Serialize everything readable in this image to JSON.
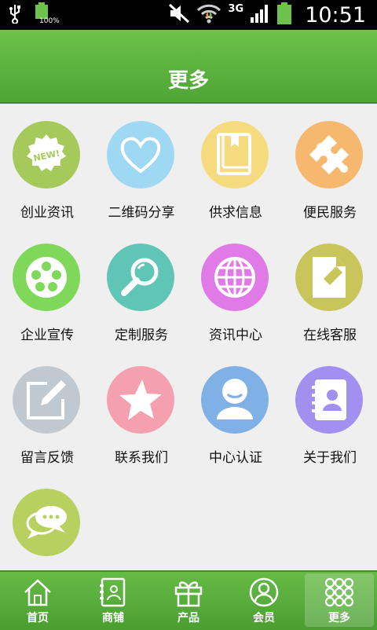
{
  "status_bar": {
    "battery_percent": "100%",
    "network": "3G",
    "time": "10:51"
  },
  "header": {
    "title": "更多"
  },
  "tiles": [
    {
      "label": "创业资讯",
      "color": "#a5c95a",
      "icon": "new-badge-icon"
    },
    {
      "label": "二维码分享",
      "color": "#9fd8f2",
      "icon": "heart-icon"
    },
    {
      "label": "供求信息",
      "color": "#f6da7e",
      "icon": "book-icon"
    },
    {
      "label": "便民服务",
      "color": "#f6b86e",
      "icon": "puzzle-icon"
    },
    {
      "label": "企业宣传",
      "color": "#7fd85a",
      "icon": "film-reel-icon"
    },
    {
      "label": "定制服务",
      "color": "#5fc6b5",
      "icon": "magnifier-icon"
    },
    {
      "label": "资讯中心",
      "color": "#e07ae6",
      "icon": "globe-icon"
    },
    {
      "label": "在线客服",
      "color": "#c8c65a",
      "icon": "document-pencil-icon"
    },
    {
      "label": "留言反馈",
      "color": "#c0c8d0",
      "icon": "edit-icon"
    },
    {
      "label": "联系我们",
      "color": "#f4a0ae",
      "icon": "star-icon"
    },
    {
      "label": "中心认证",
      "color": "#7fb0e6",
      "icon": "user-icon"
    },
    {
      "label": "关于我们",
      "color": "#a190f0",
      "icon": "contacts-book-icon"
    },
    {
      "label": "",
      "color": "#b8d060",
      "icon": "chat-bubbles-icon"
    }
  ],
  "tabbar": {
    "items": [
      {
        "label": "首页",
        "icon": "home-icon"
      },
      {
        "label": "商铺",
        "icon": "shop-icon"
      },
      {
        "label": "产品",
        "icon": "gift-icon"
      },
      {
        "label": "会员",
        "icon": "member-icon"
      },
      {
        "label": "更多",
        "icon": "grid-dots-icon",
        "active": true
      }
    ]
  }
}
